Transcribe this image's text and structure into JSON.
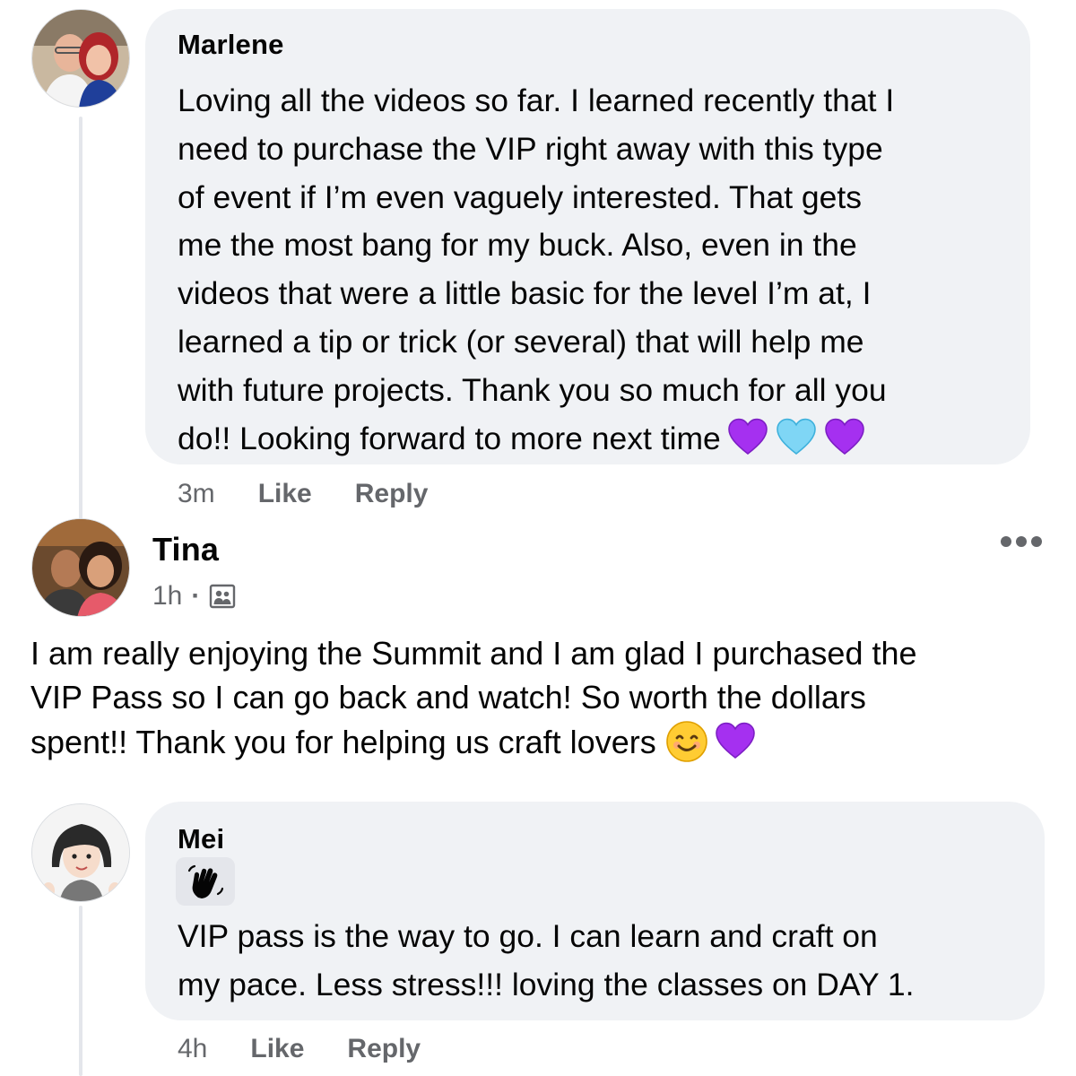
{
  "comments": [
    {
      "author": "Marlene",
      "text": "Loving all the videos so far. I learned recently that I\nneed to purchase the VIP right away with this type\nof event if I’m even vaguely interested. That gets\nme the most bang for my buck. Also, even in the\nvideos that were a little basic for the level I’m at, I\nlearned a tip or trick (or several) that will help me\nwith future projects. Thank you so much for all you\ndo!! Looking forward to more next time",
      "emojis": [
        "purple-heart",
        "light-blue-heart",
        "purple-heart"
      ],
      "time": "3m",
      "like_label": "Like",
      "reply_label": "Reply"
    },
    {
      "author": "Tina",
      "time": "1h",
      "separator": "·",
      "privacy_icon": "group-members-icon",
      "text": "I am really enjoying the Summit and I am glad I purchased the\nVIP Pass so I can go back and watch!  So worth the dollars\nspent!! Thank you for helping us craft lovers",
      "emojis": [
        "smiling-face",
        "purple-heart"
      ],
      "more_icon": "more-options-icon"
    },
    {
      "author": "Mei",
      "sticker_icon": "waving-hand-icon",
      "text": "VIP pass is the way to go.  I can learn and craft on\nmy pace.  Less stress!!! loving the classes on DAY 1.",
      "time": "4h",
      "like_label": "Like",
      "reply_label": "Reply"
    }
  ],
  "colors": {
    "bubble": "#f0f2f5",
    "meta": "#65676b",
    "purple_heart": "#a530f0",
    "light_blue_heart": "#7fd6f5"
  }
}
